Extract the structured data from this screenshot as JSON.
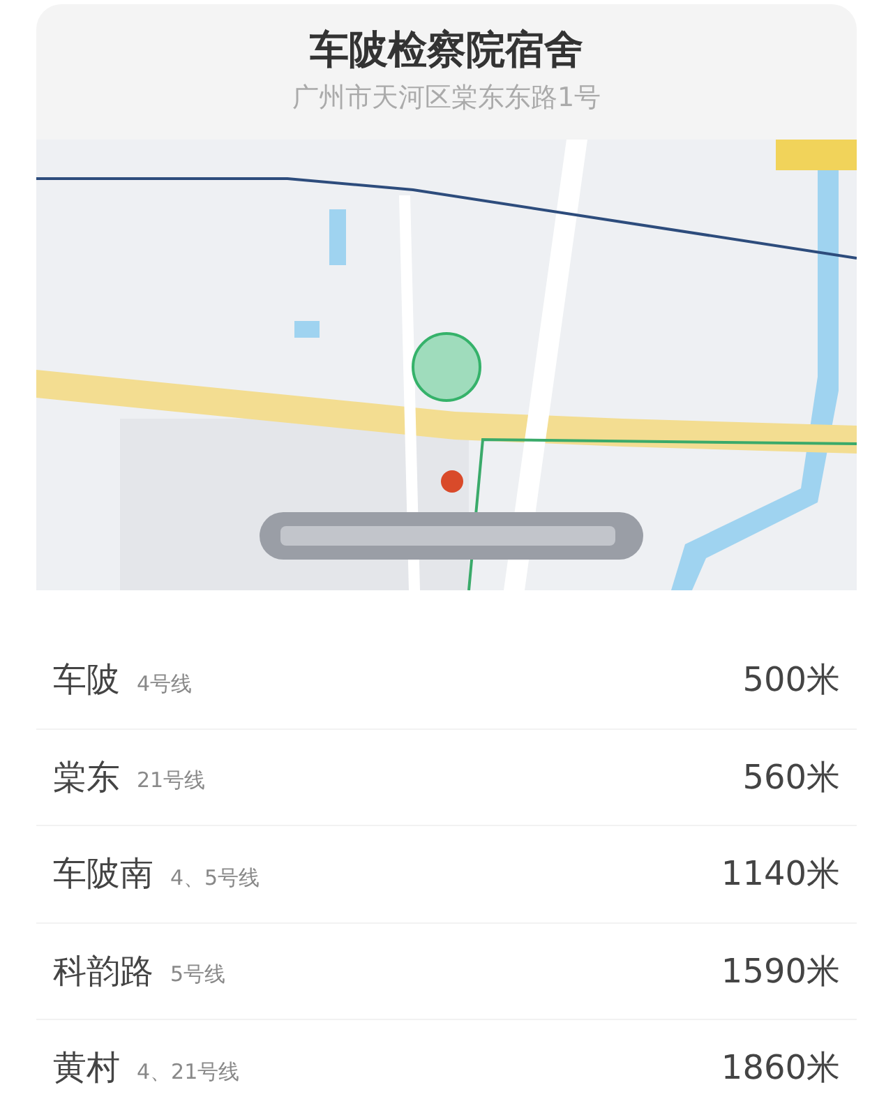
{
  "place": {
    "title": "车陂检察院宿舍",
    "address": "广州市天河区棠东东路1号"
  },
  "stations": [
    {
      "name": "车陂",
      "lines": "4号线",
      "distance": "500米"
    },
    {
      "name": "棠东",
      "lines": "21号线",
      "distance": "560米"
    },
    {
      "name": "车陂南",
      "lines": "4、5号线",
      "distance": "1140米"
    },
    {
      "name": "科韵路",
      "lines": "5号线",
      "distance": "1590米"
    },
    {
      "name": "黄村",
      "lines": "4、21号线",
      "distance": "1860米"
    }
  ]
}
